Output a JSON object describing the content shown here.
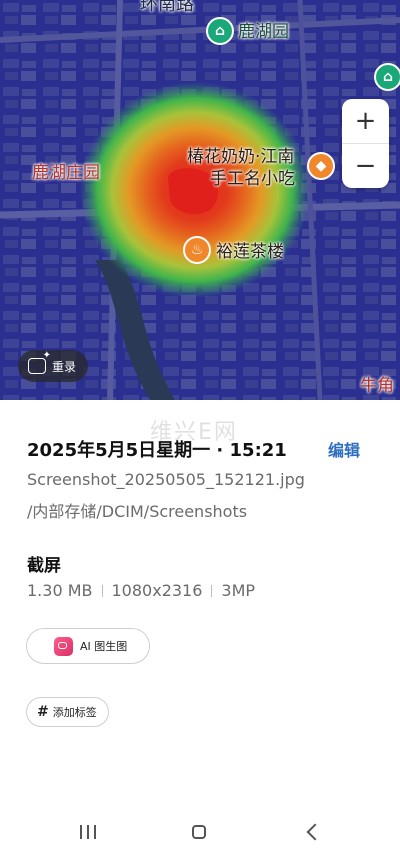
{
  "photo": {
    "map_labels": {
      "road": "环南路",
      "park_top": "鹿湖园",
      "park_left": "鹿湖庄园",
      "restaurant_line1": "椿花奶奶·江南",
      "restaurant_line2": "手工名小吃",
      "teahouse": "裕莲茶楼",
      "corner": "牛角"
    },
    "zoom_in": "+",
    "zoom_out": "−",
    "remaster_label": "重录"
  },
  "watermark": "维兴E网",
  "details": {
    "datetime": "2025年5月5日星期一 · 15:21",
    "edit_label": "编辑",
    "filename": "Screenshot_20250505_152121.jpg",
    "path": "/内部存储/DCIM/Screenshots",
    "type": "截屏",
    "size": "1.30 MB",
    "resolution": "1080x2316",
    "megapixels": "3MP"
  },
  "actions": {
    "ai_label": "AI 图生图",
    "tag_label": "添加标签",
    "tag_icon": "#"
  },
  "colors": {
    "accent": "#2f6fc2",
    "ai_icon": "#e23d73"
  }
}
